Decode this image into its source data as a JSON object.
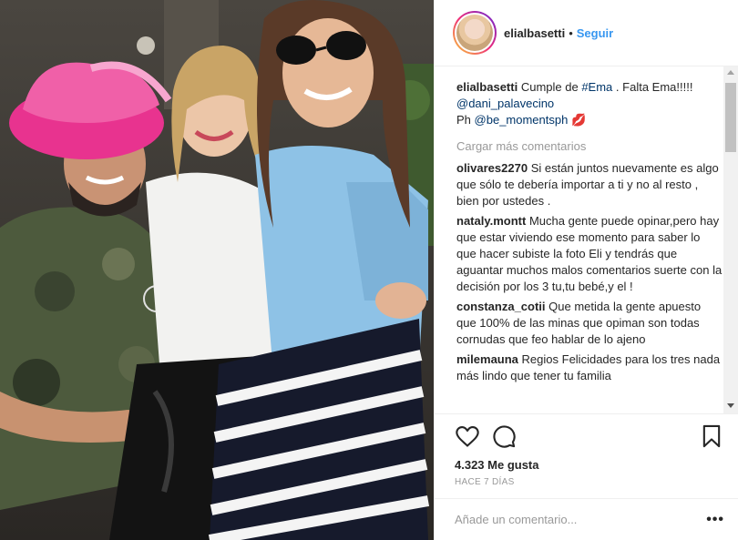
{
  "post": {
    "author": "elialbasetti",
    "separator": "•",
    "follow_label": "Seguir"
  },
  "caption": {
    "username": "elialbasetti",
    "text_before": "Cumple de",
    "hashtag": "#Ema",
    "text_after": ". Falta Ema!!!!!",
    "mention1": "@dani_palavecino",
    "ph_prefix": "Ph",
    "mention2": "@be_momentsph",
    "emoji": "💋"
  },
  "load_more_label": "Cargar más comentarios",
  "comments": [
    {
      "username": "olivares2270",
      "text": "Si están juntos nuevamente es algo que sólo te debería importar a ti y no al resto , bien por ustedes ."
    },
    {
      "username": "nataly.montt",
      "text": "Mucha gente puede opinar,pero hay que estar viviendo ese momento para saber lo que hacer subiste la foto Eli y tendrás que aguantar muchos malos comentarios suerte con la decisión por los 3 tu,tu bebé,y el !"
    },
    {
      "username": "constanza_cotii",
      "text": "Que metida la gente apuesto que 100% de las minas que opiman son todas cornudas que feo hablar de lo ajeno"
    },
    {
      "username": "milemauna",
      "text": "Regios Felicidades para los tres nada más lindo que tener tu familia"
    }
  ],
  "likes": "4.323 Me gusta",
  "time_ago": "HACE 7 DÍAS",
  "add_comment": {
    "placeholder": "Añade un comentario..."
  },
  "more_options": "•••",
  "colors": {
    "link": "#003569",
    "follow": "#3897f0",
    "muted": "#999999"
  },
  "icons": [
    "heart-icon",
    "comment-icon",
    "bookmark-icon",
    "more-options-icon"
  ]
}
